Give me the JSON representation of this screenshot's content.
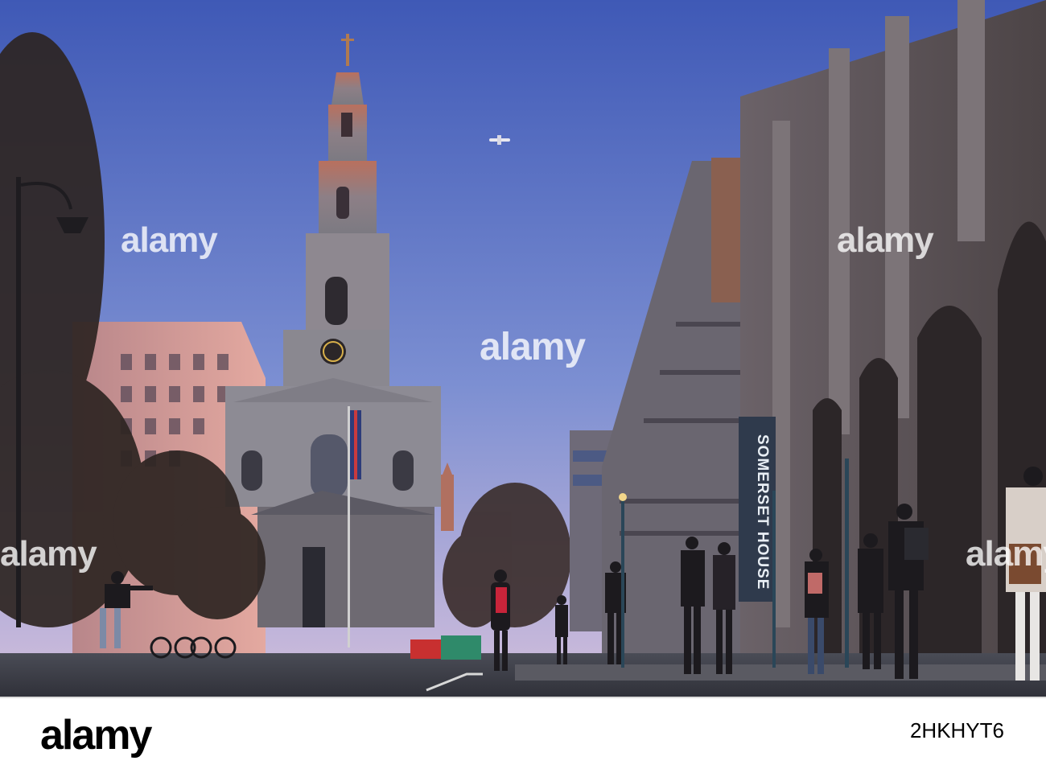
{
  "photo": {
    "watermark": "alamy",
    "banner_text": "SOMERSET HOUSE"
  },
  "footer": {
    "logo_text": "alamy",
    "image_id": "2HKHYT6"
  },
  "colors": {
    "sky_top": "#4a62b8",
    "sky_bottom": "#c7b9dc",
    "stone": "#8a8890",
    "road": "#3a3c44",
    "footer_bg": "#ffffff"
  }
}
